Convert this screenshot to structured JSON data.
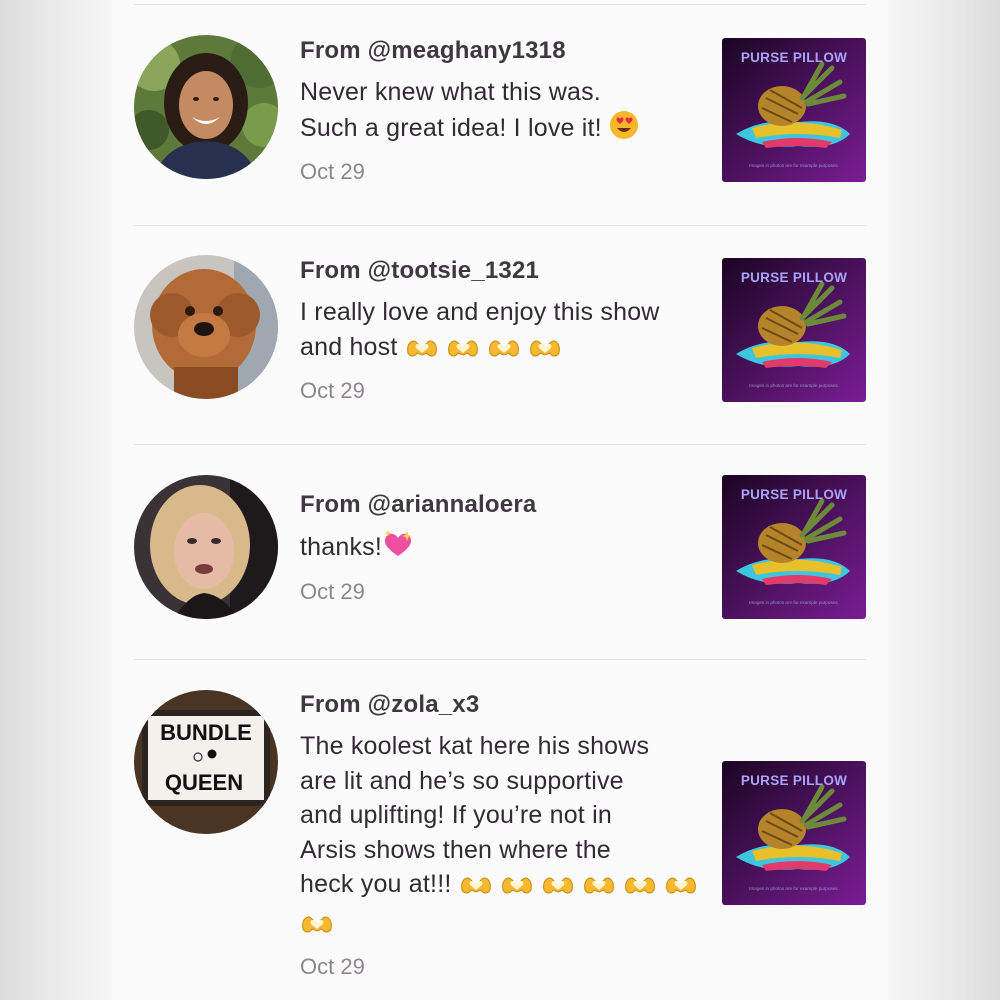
{
  "product": {
    "title": "PURSE PILLOW",
    "caption": "Images in photos are for example purposes."
  },
  "reviews": [
    {
      "username": "From @meaghany1318",
      "text_lines": [
        "Never knew what this was.",
        "Such a great idea! I love it!"
      ],
      "emojis": [
        "heart-eyes-emoji"
      ],
      "date": "Oct 29"
    },
    {
      "username": "From @tootsie_1321",
      "text_lines": [
        "I really love and enjoy this show",
        "and host"
      ],
      "emojis": [
        "heart-hands-emoji",
        "heart-hands-emoji",
        "heart-hands-emoji",
        "heart-hands-emoji"
      ],
      "date": "Oct 29"
    },
    {
      "username": "From @ariannaloera",
      "text_lines": [
        "thanks!"
      ],
      "emojis": [
        "sparkling-heart-emoji"
      ],
      "date": "Oct 29"
    },
    {
      "username": "From @zola_x3",
      "text_lines": [
        "The koolest kat here his shows",
        "are lit and he’s so supportive",
        "and uplifting! If you’re not in",
        "Arsis shows then where the",
        "heck you at!!!"
      ],
      "emojis": [
        "heart-hands-emoji",
        "heart-hands-emoji",
        "heart-hands-emoji",
        "heart-hands-emoji",
        "heart-hands-emoji",
        "heart-hands-emoji",
        "heart-hands-emoji"
      ],
      "date": "Oct 29",
      "avatar_sign": [
        "BUNDLE",
        "QUEEN"
      ]
    }
  ],
  "colors": {
    "thumb_bg": "#2a0a35",
    "thumb_accent": "#6a1585",
    "title_text": "#a9a3ff"
  }
}
